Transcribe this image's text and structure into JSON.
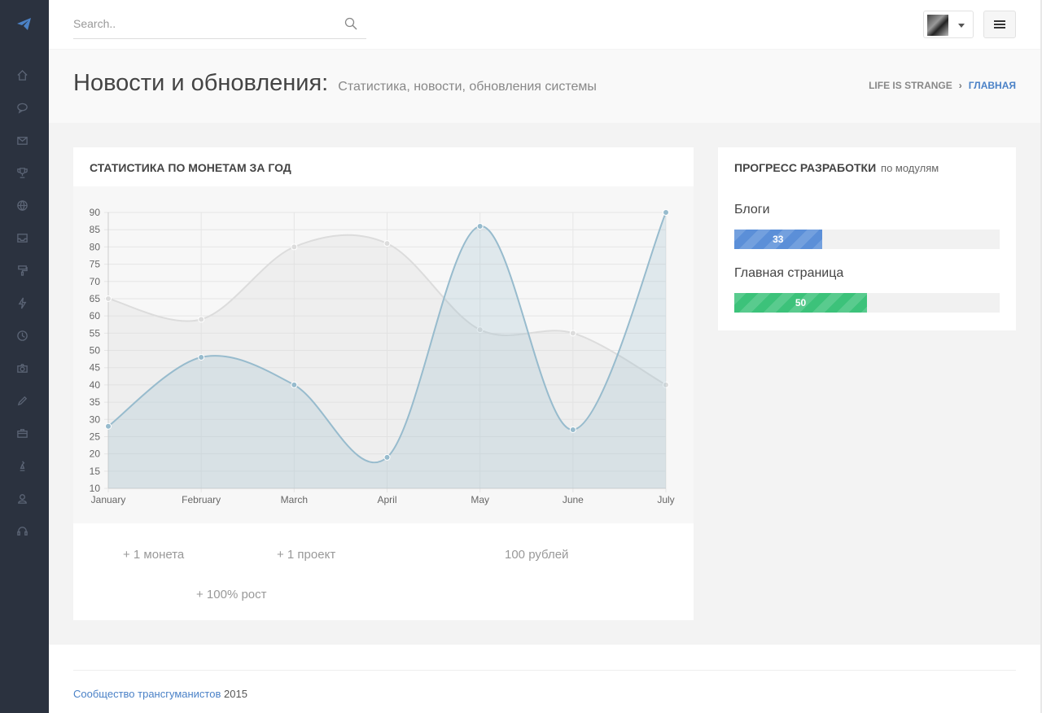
{
  "search": {
    "placeholder": "Search.."
  },
  "header": {
    "title": "Новости и обновления:",
    "subtitle": "Статистика, новости, обновления системы",
    "breadcrumb": {
      "home": "LIFE IS STRANGE",
      "current": "ГЛАВНАЯ"
    }
  },
  "sidebar": {
    "icons": [
      "home-icon",
      "chat-icon",
      "mail-icon",
      "trophy-icon",
      "globe-icon",
      "inbox-icon",
      "paint-roller-icon",
      "bolt-icon",
      "clock-icon",
      "camera-icon",
      "pencil-icon",
      "briefcase-icon",
      "chess-piece-icon",
      "user-icon",
      "headset-icon"
    ]
  },
  "chart_panel": {
    "title": "Статистика по монетам за год",
    "stats": [
      "+ 1 монета",
      "+ 1 проект",
      "100 рублей",
      "+ 100% рост"
    ]
  },
  "chart_data": {
    "type": "line",
    "categories": [
      "January",
      "February",
      "March",
      "April",
      "May",
      "June",
      "July"
    ],
    "ylim": [
      10,
      90
    ],
    "yticks": [
      10,
      15,
      20,
      25,
      30,
      35,
      40,
      45,
      50,
      55,
      60,
      65,
      70,
      75,
      80,
      85,
      90
    ],
    "grid": true,
    "series": [
      {
        "values": [
          65,
          59,
          80,
          81,
          56,
          55,
          40
        ],
        "color": "#dcdcdc"
      },
      {
        "values": [
          28,
          48,
          40,
          19,
          86,
          27,
          90
        ],
        "color": "#97bbcd"
      }
    ]
  },
  "progress_panel": {
    "title": "Прогресс разработки",
    "subtitle": "по модулям",
    "items": [
      {
        "label": "Блоги",
        "value": 33,
        "color": "#5b8fd8"
      },
      {
        "label": "Главная страница",
        "value": 50,
        "color": "#3cc27a"
      }
    ]
  },
  "footer": {
    "link": "Сообщество трансгуманистов",
    "year": "2015"
  },
  "colors": {
    "sidebar": "#2b323f",
    "accent": "#4b82c7"
  }
}
